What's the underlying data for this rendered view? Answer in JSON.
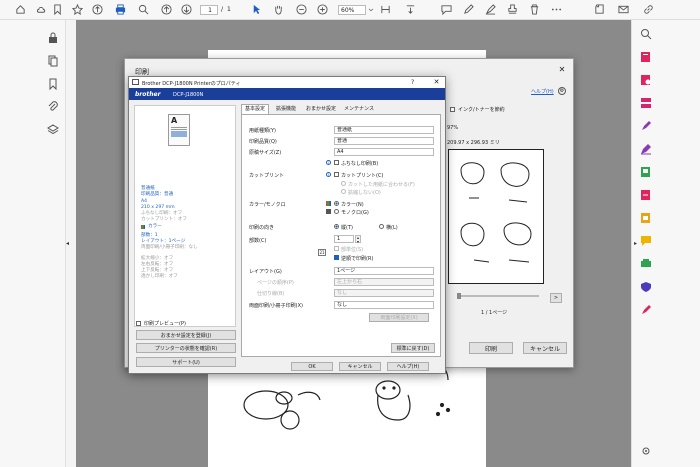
{
  "toolbar": {
    "page_current": "1",
    "page_sep": "/",
    "page_total": "1",
    "zoom": "60%"
  },
  "print_dialog": {
    "title": "印刷",
    "help_link": "ヘルプ(H)",
    "ink_toner_save": "インク/トナーを節約",
    "scale_pct": "97%",
    "paper_size": "209.97 x 296.93 ミリ",
    "page_nav": "1 / 1ページ",
    "next": ">",
    "print_btn": "印刷",
    "cancel_btn": "キャンセル"
  },
  "prop_dialog": {
    "title": "Brother DCP-J1800N Printerのプロパティ",
    "question": "?",
    "logo": "brother",
    "model": "DCP-J1800N",
    "tabs": [
      "基本設定",
      "拡張機能",
      "おまかせ設定",
      "メンテナンス"
    ],
    "side_summary": [
      "普通紙",
      "印刷品質：普通",
      "A4",
      "210 x 297 mm",
      "ふちなし印刷：オフ",
      "カットプリント：オフ",
      "カラー",
      "部数：1",
      "レイアウト：1ページ",
      "両面印刷/小冊子印刷：なし",
      "拡大縮小：オフ",
      "左右反転：オフ",
      "上下反転：オフ",
      "透かし印刷：オフ"
    ],
    "fields": {
      "paper_type_label": "用紙種類(Y)",
      "paper_type": "普通紙",
      "quality_label": "印刷品質(Q)",
      "quality": "普通",
      "size_label": "原稿サイズ(Z)",
      "size": "A4",
      "borderless": "ふちなし印刷(B)",
      "cut_label": "カットプリント",
      "cut_chk": "カットプリント(C)",
      "cut_opt1": "カットした用紙に合わせる(F)",
      "cut_opt2": "拡縮しない(O)",
      "color_label": "カラー/モノクロ",
      "color_opt": "カラー(N)",
      "mono_opt": "モノクロ(G)",
      "orient_label": "印刷の向き",
      "portrait": "縦(T)",
      "landscape": "横(L)",
      "copies_label": "部数(C)",
      "copies": "1",
      "collate": "部単位(S)",
      "reverse": "逆順で印刷(R)",
      "layout_label": "レイアウト(G)",
      "layout": "1ページ",
      "page_order_label": "ページの順序(P)",
      "page_order": "左上から右",
      "border_label": "仕切り線(B)",
      "border": "なし",
      "duplex_label": "両面印刷/小冊子印刷(X)",
      "duplex": "なし",
      "duplex_settings": "両面印刷設定(X)",
      "restore": "標準に戻す(D)"
    },
    "side_buttons": {
      "preview": "印刷プレビュー(P)",
      "register": "おまかせ設定を登録(J)",
      "status": "プリンターの状態を確認(R)",
      "support": "サポート(U)"
    },
    "ok": "OK",
    "cancel": "キャンセル",
    "help": "ヘルプ(H)"
  },
  "colors": {
    "accent": "#1f5fc4",
    "brother_blue": "#1a3f9a",
    "canvas": "#8a8a8a"
  }
}
